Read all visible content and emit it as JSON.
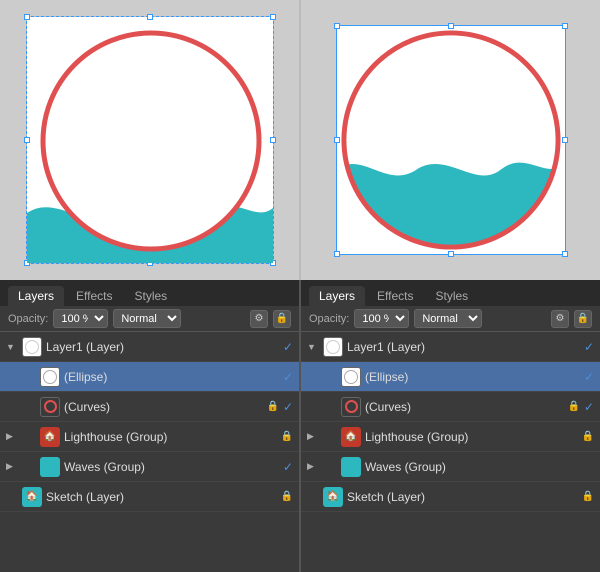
{
  "canvases": [
    {
      "id": "left",
      "hasWave": true,
      "waveColor": "#2db8c0"
    },
    {
      "id": "right",
      "hasWave": true,
      "waveColor": "#2db8c0"
    }
  ],
  "panels": [
    {
      "id": "left",
      "tabs": [
        "Layers",
        "Effects",
        "Styles"
      ],
      "activeTab": "Layers",
      "opacity": {
        "label": "Opacity:",
        "value": "100 %",
        "mode": "Normal"
      },
      "layers": [
        {
          "id": "layer1",
          "name": "Layer1 (Layer)",
          "thumb": "white-circle",
          "indent": 0,
          "expanded": true,
          "visible": true,
          "locked": false,
          "selected": false
        },
        {
          "id": "ellipse",
          "name": "(Ellipse)",
          "thumb": "white-circle",
          "indent": 1,
          "expanded": false,
          "visible": true,
          "locked": false,
          "selected": true
        },
        {
          "id": "curves",
          "name": "(Curves)",
          "thumb": "red-circle",
          "indent": 1,
          "expanded": false,
          "visible": false,
          "locked": true,
          "selected": false
        },
        {
          "id": "lighthouse",
          "name": "Lighthouse (Group)",
          "thumb": "lighthouse",
          "indent": 1,
          "expanded": false,
          "visible": false,
          "locked": true,
          "selected": false
        },
        {
          "id": "waves",
          "name": "Waves (Group)",
          "thumb": "waves",
          "indent": 1,
          "expanded": false,
          "visible": true,
          "locked": false,
          "selected": false
        },
        {
          "id": "sketch",
          "name": "Sketch (Layer)",
          "thumb": "sketch",
          "indent": 0,
          "expanded": false,
          "visible": false,
          "locked": true,
          "selected": false
        }
      ]
    },
    {
      "id": "right",
      "tabs": [
        "Layers",
        "Effects",
        "Styles"
      ],
      "activeTab": "Layers",
      "opacity": {
        "label": "Opacity:",
        "value": "100 %",
        "mode": "Normal"
      },
      "layers": [
        {
          "id": "layer1",
          "name": "Layer1 (Layer)",
          "thumb": "white-circle",
          "indent": 0,
          "expanded": true,
          "visible": true,
          "locked": false,
          "selected": false
        },
        {
          "id": "ellipse",
          "name": "(Ellipse)",
          "thumb": "white-circle",
          "indent": 1,
          "expanded": false,
          "visible": true,
          "locked": false,
          "selected": true
        },
        {
          "id": "curves",
          "name": "(Curves)",
          "thumb": "red-circle",
          "indent": 1,
          "expanded": false,
          "visible": false,
          "locked": true,
          "selected": false
        },
        {
          "id": "lighthouse",
          "name": "Lighthouse (Group)",
          "thumb": "lighthouse",
          "indent": 1,
          "expanded": false,
          "visible": false,
          "locked": true,
          "selected": false
        },
        {
          "id": "waves",
          "name": "Waves (Group)",
          "thumb": "waves",
          "indent": 1,
          "expanded": false,
          "visible": false,
          "locked": false,
          "selected": false
        },
        {
          "id": "sketch",
          "name": "Sketch (Layer)",
          "thumb": "sketch",
          "indent": 0,
          "expanded": false,
          "visible": false,
          "locked": true,
          "selected": false
        }
      ]
    }
  ],
  "colors": {
    "wave": "#2db8c0",
    "circleStroke": "#e05050",
    "selectionBlue": "#3399ff",
    "layerSelected": "#4a6fa5",
    "panelBg": "#3a3a3a",
    "checkBlue": "#4a90d9"
  }
}
